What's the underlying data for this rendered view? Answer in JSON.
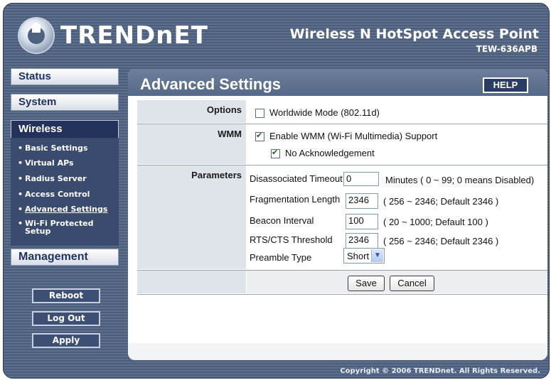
{
  "header": {
    "logo_text": "TRENDnET",
    "product_name": "Wireless N HotSpot Access Point",
    "model_number": "TEW-636APB"
  },
  "sidebar": {
    "status": "Status",
    "system": "System",
    "wireless": "Wireless",
    "wireless_items": [
      "Basic Settings",
      "Virtual APs",
      "Radius Server",
      "Access Control",
      "Advanced Settings",
      "Wi-Fi Protected Setup"
    ],
    "active_item": "Advanced Settings",
    "management": "Management",
    "buttons": {
      "reboot": "Reboot",
      "logout": "Log Out",
      "apply": "Apply"
    }
  },
  "main": {
    "title": "Advanced Settings",
    "help": "HELP",
    "options": {
      "label": "Options",
      "worldwide_mode": "Worldwide Mode (802.11d)",
      "worldwide_checked": false
    },
    "wmm": {
      "label": "WMM",
      "enable_wmm": "Enable WMM (Wi-Fi Multimedia) Support",
      "enable_checked": true,
      "no_ack": "No Acknowledgement",
      "no_ack_checked": true
    },
    "parameters": {
      "label": "Parameters",
      "disassociated_timeout": {
        "label": "Disassociated Timeout",
        "value": "0",
        "hint": "Minutes ( 0 ~ 99; 0 means Disabled)"
      },
      "fragmentation_length": {
        "label": "Fragmentation Length",
        "value": "2346",
        "hint": "( 256 ~ 2346; Default 2346 )"
      },
      "beacon_interval": {
        "label": "Beacon Interval",
        "value": "100",
        "hint": "( 20 ~ 1000; Default 100 )"
      },
      "rts_cts_threshold": {
        "label": "RTS/CTS Threshold",
        "value": "2346",
        "hint": "( 256 ~ 2346; Default 2346 )"
      },
      "preamble_type": {
        "label": "Preamble Type",
        "value": "Short"
      }
    },
    "save": "Save",
    "cancel": "Cancel"
  },
  "footer": {
    "copyright": "Copyright © 2006 TRENDnet. All Rights Reserved."
  },
  "colors": {
    "accent": "#23325a",
    "panel_header": "#5c6f8c",
    "label_bg": "#dfe3ea"
  }
}
